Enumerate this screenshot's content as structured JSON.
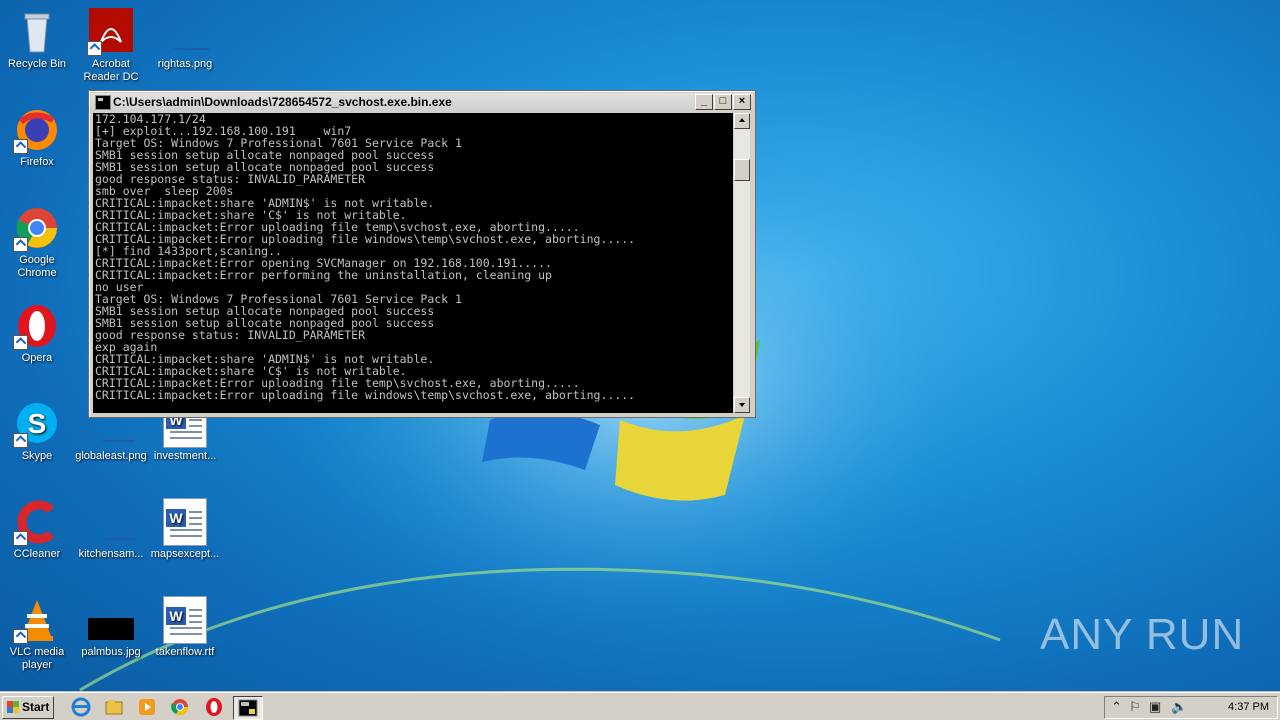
{
  "desktop": {
    "icons": [
      {
        "label": "Recycle Bin",
        "icon": "recycle-bin-icon"
      },
      {
        "label": "Acrobat Reader DC",
        "icon": "acrobat-icon"
      },
      {
        "label": "rightas.png",
        "icon": "png-file-icon"
      },
      {
        "label": "Firefox",
        "icon": "firefox-icon"
      },
      {
        "label": "Google Chrome",
        "icon": "chrome-icon"
      },
      {
        "label": "Opera",
        "icon": "opera-icon"
      },
      {
        "label": "Skype",
        "icon": "skype-icon"
      },
      {
        "label": "globaleast.png",
        "icon": "png-file-icon"
      },
      {
        "label": "investment...",
        "icon": "word-doc-icon"
      },
      {
        "label": "CCleaner",
        "icon": "ccleaner-icon"
      },
      {
        "label": "kitchensam...",
        "icon": "png-file-icon"
      },
      {
        "label": "mapsexcept...",
        "icon": "word-doc-icon"
      },
      {
        "label": "VLC media player",
        "icon": "vlc-icon"
      },
      {
        "label": "palmbus.jpg",
        "icon": "jpg-file-icon"
      },
      {
        "label": "takenflow.rtf",
        "icon": "word-doc-icon"
      }
    ],
    "watermark": "ANY RUN"
  },
  "window": {
    "title": "C:\\Users\\admin\\Downloads\\728654572_svchost.exe.bin.exe",
    "buttons": {
      "minimize": "_",
      "maximize": "□",
      "close": "×"
    },
    "lines": [
      "172.104.177.1/24",
      "[+] exploit...192.168.100.191    win7",
      "Target OS: Windows 7 Professional 7601 Service Pack 1",
      "SMB1 session setup allocate nonpaged pool success",
      "SMB1 session setup allocate nonpaged pool success",
      "good response status: INVALID_PARAMETER",
      "smb over  sleep 200s",
      "CRITICAL:impacket:share 'ADMIN$' is not writable.",
      "CRITICAL:impacket:share 'C$' is not writable.",
      "CRITICAL:impacket:Error uploading file temp\\svchost.exe, aborting.....",
      "CRITICAL:impacket:Error uploading file windows\\temp\\svchost.exe, aborting.....",
      "[*] find 1433port,scaning..",
      "CRITICAL:impacket:Error opening SVCManager on 192.168.100.191.....",
      "CRITICAL:impacket:Error performing the uninstallation, cleaning up",
      "no user",
      "Target OS: Windows 7 Professional 7601 Service Pack 1",
      "SMB1 session setup allocate nonpaged pool success",
      "SMB1 session setup allocate nonpaged pool success",
      "good response status: INVALID_PARAMETER",
      "exp again",
      "CRITICAL:impacket:share 'ADMIN$' is not writable.",
      "CRITICAL:impacket:share 'C$' is not writable.",
      "CRITICAL:impacket:Error uploading file temp\\svchost.exe, aborting.....",
      "CRITICAL:impacket:Error uploading file windows\\temp\\svchost.exe, aborting....."
    ]
  },
  "taskbar": {
    "start_label": "Start",
    "clock": "4:37 PM"
  },
  "colors": {
    "console_bg": "#000000",
    "console_text": "#c0c0c0",
    "taskbar": "#d4d0c8",
    "desktop": "#1a8fd6"
  }
}
